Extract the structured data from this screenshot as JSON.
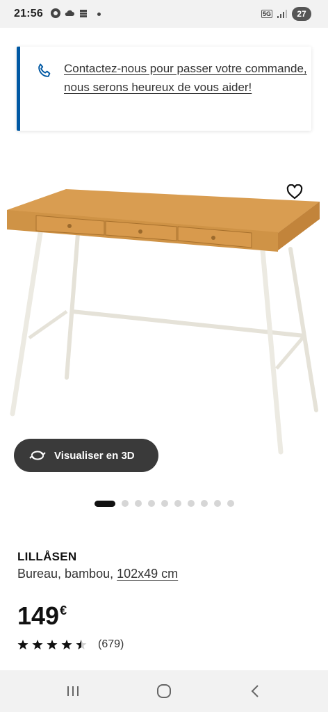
{
  "status_bar": {
    "time": "21:56",
    "network": "5G",
    "battery": "27"
  },
  "contact_banner": {
    "text": "Contactez-nous pour passer votre commande, nous serons heureux de vous aider!",
    "icon": "phone-icon"
  },
  "product_view": {
    "view3d_label": "Visualiser en 3D",
    "favourite_icon": "heart-icon",
    "carousel_total": 10,
    "carousel_active": 1
  },
  "product": {
    "name": "LILLÅSEN",
    "description": "Bureau, bambou,",
    "size": "102x49 cm",
    "price": "149",
    "currency": "€",
    "rating_value": 4.5,
    "reviews": "(679)"
  },
  "colors": {
    "accent": "#0058a3",
    "dark_button": "#3a3a3a",
    "desk_wood": "#d79a4c",
    "desk_legs": "#e9e7de"
  }
}
